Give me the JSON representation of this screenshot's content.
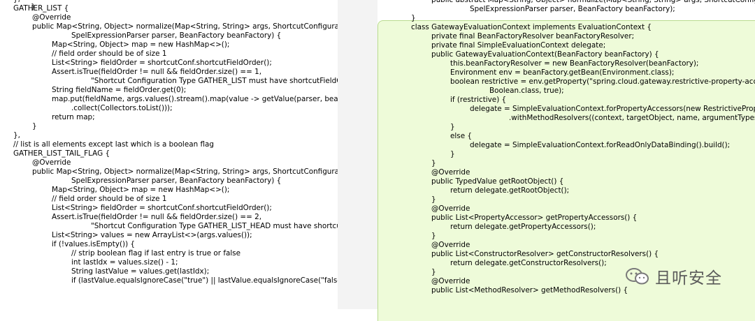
{
  "left_code": [
    "}",
    "},",
    "GATHER_LIST {",
    "@Override",
    "public Map<String, Object> normalize(Map<String, String> args, ShortcutConfigurable s",
    "SpelExpressionParser parser, BeanFactory beanFactory) {",
    "Map<String, Object> map = new HashMap<>();",
    "// field order should be of size 1",
    "List<String> fieldOrder = shortcutConf.shortcutFieldOrder();",
    "Assert.isTrue(fieldOrder != null && fieldOrder.size() == 1,",
    "\"Shortcut Configuration Type GATHER_LIST must have shortcutFieldOrd",
    "String fieldName = fieldOrder.get(0);",
    "map.put(fieldName, args.values().stream().map(value -> getValue(parser, beanFa",
    ".collect(Collectors.toList()));",
    "return map;",
    "}",
    "},",
    "// list is all elements except last which is a boolean flag",
    "GATHER_LIST_TAIL_FLAG {",
    "@Override",
    "public Map<String, Object> normalize(Map<String, String> args, ShortcutConfigurable s",
    "SpelExpressionParser parser, BeanFactory beanFactory) {",
    "Map<String, Object> map = new HashMap<>();",
    "// field order should be of size 1",
    "List<String> fieldOrder = shortcutConf.shortcutFieldOrder();",
    "Assert.isTrue(fieldOrder != null && fieldOrder.size() == 2,",
    "\"Shortcut Configuration Type GATHER_LIST_HEAD must have shortcutF",
    "List<String> values = new ArrayList<>(args.values());",
    "if (!values.isEmpty()) {",
    "// strip boolean flag if last entry is true or false",
    "int lastIdx = values.size() - 1;",
    "String lastValue = values.get(lastIdx);",
    "if (lastValue.equalsIgnoreCase(\"true\") || lastValue.equalsIgnoreCase(\"false\"))"
  ],
  "right_code": [
    "public abstract Map<String, Object> normalize(Map<String, String> args, ShortcutConfigurabl",
    "SpelExpressionParser parser, BeanFactory beanFactory);",
    "}",
    "class GatewayEvaluationContext implements EvaluationContext {",
    "private final BeanFactoryResolver beanFactoryResolver;",
    "private final SimpleEvaluationContext delegate;",
    "public GatewayEvaluationContext(BeanFactory beanFactory) {",
    "this.beanFactoryResolver = new BeanFactoryResolver(beanFactory);",
    "Environment env = beanFactory.getBean(Environment.class);",
    "boolean restrictive = env.getProperty(\"spring.cloud.gateway.restrictive-property-accesso",
    "Boolean.class, true);",
    "if (restrictive) {",
    "delegate = SimpleEvaluationContext.forPropertyAccessors(new RestrictivePropertyA",
    ".withMethodResolvers((context, targetObject, name, argumentTypes) ->",
    "}",
    "else {",
    "delegate = SimpleEvaluationContext.forReadOnlyDataBinding().build();",
    "}",
    "}",
    "@Override",
    "public TypedValue getRootObject() {",
    "return delegate.getRootObject();",
    "}",
    "@Override",
    "public List<PropertyAccessor> getPropertyAccessors() {",
    "return delegate.getPropertyAccessors();",
    "}",
    "@Override",
    "public List<ConstructorResolver> getConstructorResolvers() {",
    "return delegate.getConstructorResolvers();",
    "}",
    "@Override",
    "public List<MethodResolver> getMethodResolvers() {"
  ],
  "watermark": {
    "text": "且听安全",
    "icon": "wechat-official-account-icon"
  },
  "colors": {
    "left_bg": "#ffffff",
    "gap_bg": "#f3f3f3",
    "right_highlight_bg": "#eefbd9",
    "right_highlight_border": "#b9db8e",
    "code_text": "#000000",
    "watermark_text": "#5a5a5a"
  }
}
